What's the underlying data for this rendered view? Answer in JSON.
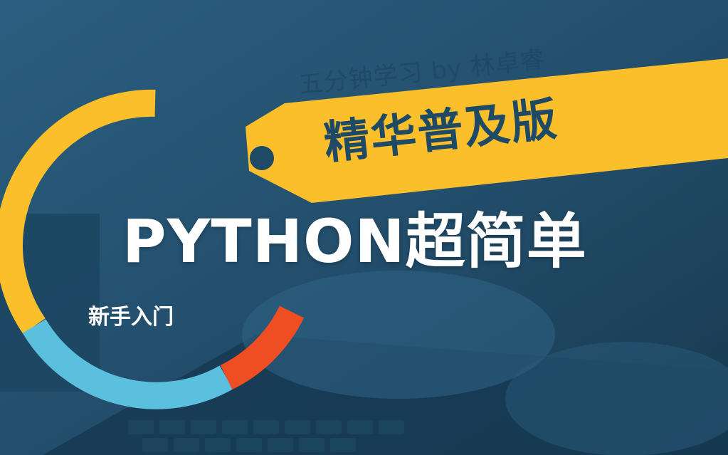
{
  "author_line": "五分钟学习 by 林卓睿",
  "edition_label": "精华普及版",
  "headline": "PYTHON超简单",
  "subheadline": "新手入门",
  "colors": {
    "background": "#1f4a66",
    "accent_yellow": "#fbbf2c",
    "accent_blue": "#5bc0de",
    "accent_red": "#ef4e23",
    "text_dark": "#1f4a66",
    "text_light": "#ffffff"
  }
}
